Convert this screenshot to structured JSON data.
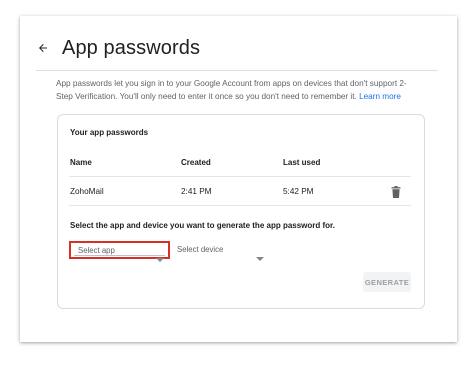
{
  "page": {
    "title": "App passwords",
    "intro_text": "App passwords let you sign in to your Google Account from apps on devices that don't support 2-Step Verification. You'll only need to enter it once so you don't need to remember it.",
    "learn_more_label": "Learn more"
  },
  "passwords": {
    "section_title": "Your app passwords",
    "columns": [
      "Name",
      "Created",
      "Last used"
    ],
    "rows": [
      {
        "name": "ZohoMail",
        "created": "2:41 PM",
        "last_used": "5:42 PM",
        "action_icon": "trash-icon"
      }
    ]
  },
  "generator": {
    "prompt": "Select the app and device you want to generate the app password for.",
    "select_app_value": "Select app",
    "select_device_value": "Select device",
    "generate_label": "GENERATE"
  },
  "colors": {
    "link": "#1a73e8",
    "highlight_border": "#d93025",
    "disabled_button_bg": "#f1f3f4",
    "disabled_button_text": "#9aa0a6"
  },
  "icons": {
    "back": "arrow-left-icon",
    "delete": "trash-icon",
    "dropdown": "caret-down-icon"
  }
}
